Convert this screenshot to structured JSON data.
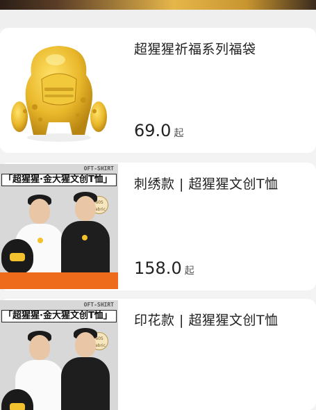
{
  "products": [
    {
      "title": "超猩猩祈福系列福袋",
      "price": "69.0",
      "price_suffix": "起"
    },
    {
      "title": "刺绣款 | 超猩猩文创T恤",
      "price": "158.0",
      "price_suffix": "起"
    },
    {
      "title": "印花款 | 超猩猩文创T恤"
    }
  ],
  "poster": {
    "tag": "OFT-SHIRT",
    "headline": "「超猩猩·金大猩文创T恤」",
    "badge": "60S Fabric"
  },
  "colors": {
    "accent_orange": "#ee6b1c",
    "gold": "#e6b64a",
    "text": "#222222"
  }
}
